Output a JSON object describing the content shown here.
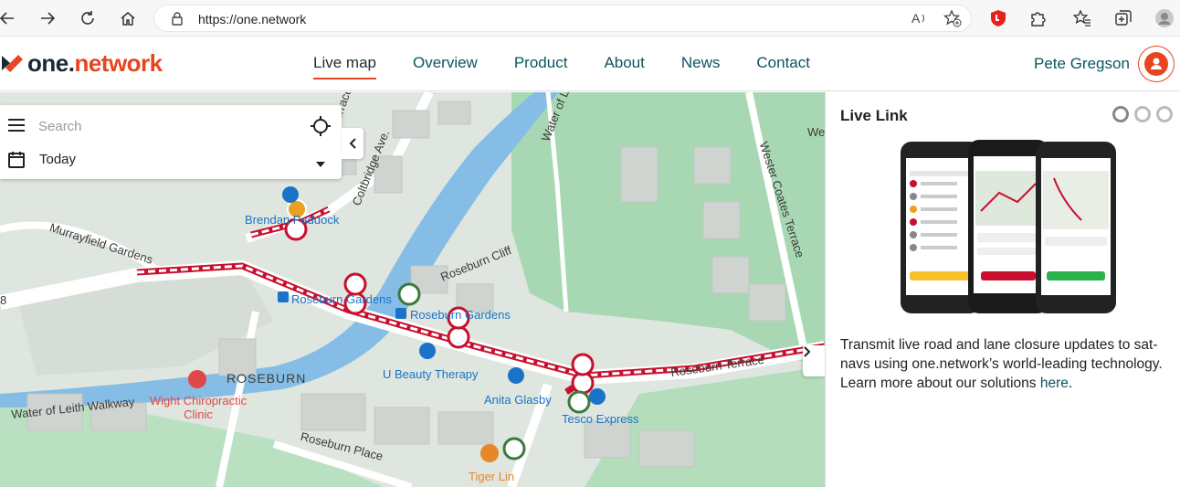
{
  "browser": {
    "url": "https://one.network"
  },
  "site": {
    "logo_prefix": "one.",
    "logo_suffix": "network",
    "nav": [
      {
        "label": "Live map",
        "active": true
      },
      {
        "label": "Overview"
      },
      {
        "label": "Product"
      },
      {
        "label": "About"
      },
      {
        "label": "News"
      },
      {
        "label": "Contact"
      }
    ],
    "user_name": "Pete Gregson"
  },
  "search": {
    "placeholder": "Search",
    "date_filter": "Today"
  },
  "map": {
    "street_labels": [
      "Coltbridge Ave.",
      "Terrace",
      "Water of L",
      "Murrayfield Gardens",
      "Roseburn Cliff",
      "Roseburn Terrace",
      "Roseburn Place",
      "Water of Leith Walkway",
      "Wester Coates Terrace",
      "We",
      "8"
    ],
    "area_label": "ROSEBURN",
    "pois": [
      {
        "name": "Brendan Paddock",
        "color": "#1a73c7"
      },
      {
        "name": "Roseburn Gardens",
        "color": "#1a73c7"
      },
      {
        "name": "Roseburn Gardens",
        "color": "#1a73c7"
      },
      {
        "name": "U Beauty Therapy",
        "color": "#1a73c7"
      },
      {
        "name": "Anita Glasby",
        "color": "#1a73c7"
      },
      {
        "name": "Tesco Express",
        "color": "#1a73c7"
      },
      {
        "name": "Wight Chiropractic Clinic",
        "color": "#e04848"
      },
      {
        "name": "Tiger Lin",
        "color": "#e8862a"
      }
    ]
  },
  "panel": {
    "title": "Live Link",
    "body": "Transmit live road and lane closure updates to sat-navs using one.network’s world-leading technology. Learn more about our solutions ",
    "link_text": "here",
    "body_end": "."
  },
  "colors": {
    "brand_orange": "#e8451f",
    "brand_teal": "#0b5560",
    "closure_red": "#c8102e"
  },
  "icons": [
    "back-icon",
    "forward-icon",
    "refresh-icon",
    "home-icon",
    "lock-icon",
    "read-aloud-icon",
    "favorite-add-icon",
    "shield-icon",
    "extensions-icon",
    "favorites-icon",
    "collections-icon",
    "profile-icon",
    "menu-icon",
    "locate-icon",
    "calendar-icon",
    "caret-down-icon",
    "chevron-left-icon",
    "chevron-right-icon",
    "user-icon",
    "roadworks-icon"
  ]
}
